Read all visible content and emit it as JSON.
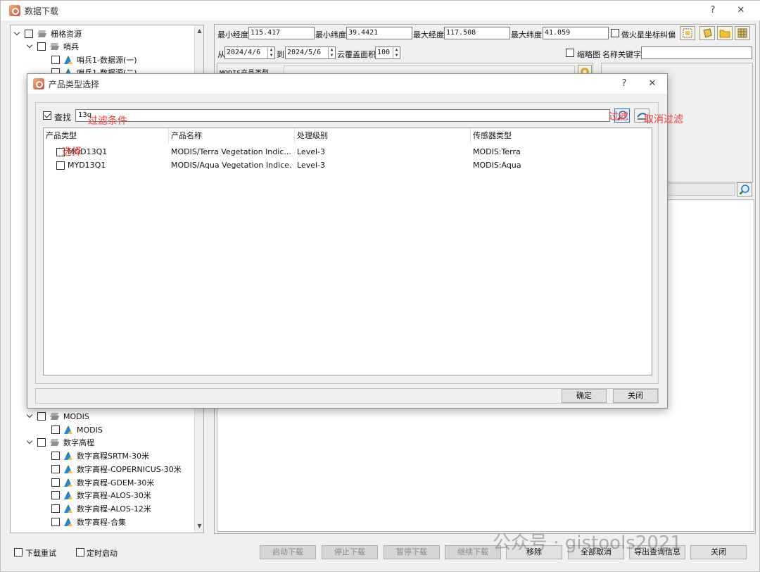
{
  "main_window": {
    "title": "数据下载",
    "help_glyph": "?",
    "close_glyph": "✕"
  },
  "tree": {
    "items": [
      {
        "label": "栅格资源",
        "level": 0,
        "expanded": true,
        "icon": "layers-icon"
      },
      {
        "label": "哨兵",
        "level": 1,
        "expanded": true,
        "icon": "layers-icon"
      },
      {
        "label": "哨兵1-数据源(一)",
        "level": 2,
        "icon": "raster-icon"
      },
      {
        "label": "哨兵1-数据源(二)",
        "level": 2,
        "icon": "raster-icon"
      },
      {
        "label": "MODIS",
        "level": 1,
        "expanded": true,
        "icon": "layers-icon"
      },
      {
        "label": "MODIS",
        "level": 2,
        "icon": "raster-icon"
      },
      {
        "label": "数字高程",
        "level": 1,
        "expanded": true,
        "icon": "layers-icon"
      },
      {
        "label": "数字高程SRTM-30米",
        "level": 2,
        "icon": "raster-icon"
      },
      {
        "label": "数字高程-COPERNICUS-30米",
        "level": 2,
        "icon": "raster-icon"
      },
      {
        "label": "数字高程-GDEM-30米",
        "level": 2,
        "icon": "raster-icon"
      },
      {
        "label": "数字高程-ALOS-30米",
        "level": 2,
        "icon": "raster-icon"
      },
      {
        "label": "数字高程-ALOS-12米",
        "level": 2,
        "icon": "raster-icon"
      },
      {
        "label": "数字高程-合集",
        "level": 2,
        "icon": "raster-icon"
      }
    ]
  },
  "query": {
    "min_lon_label": "最小经度",
    "min_lon": "115.417",
    "min_lat_label": "最小纬度",
    "min_lat": "39.4421",
    "max_lon_label": "最大经度",
    "max_lon": "117.508",
    "max_lat_label": "最大纬度",
    "max_lat": "41.059",
    "mars_label": "做火星坐标纠偏",
    "from_label": "从",
    "from_date": "2024/4/6",
    "to_label": "到",
    "to_date": "2024/5/6",
    "cloud_label": "云覆盖面积",
    "cloud_value": "100",
    "thumb_label": "缩略图",
    "keyword_label": "名称关键字",
    "keyword_value": "",
    "modis_type_label": "MODIS产品类型"
  },
  "dialog": {
    "title": "产品类型选择",
    "help_glyph": "?",
    "close_glyph": "✕",
    "find_label": "查找",
    "find_value": "13q",
    "columns": [
      "产品类型",
      "产品名称",
      "处理级别",
      "传感器类型"
    ],
    "rows": [
      {
        "type": "MOD13Q1",
        "name": "MODIS/Terra Vegetation Indic...",
        "level": "Level-3",
        "sensor": "MODIS:Terra"
      },
      {
        "type": "MYD13Q1",
        "name": "MODIS/Aqua Vegetation Indice...",
        "level": "Level-3",
        "sensor": "MODIS:Aqua"
      }
    ],
    "ok_label": "确定",
    "close_label": "关闭",
    "annotations": {
      "filter_condition": "过滤条件",
      "filter": "过滤",
      "cancel_filter": "取消过滤",
      "select": "选择"
    }
  },
  "bottom": {
    "redownload_label": "下载重试",
    "timed_start_label": "定时启动",
    "buttons": [
      "启动下载",
      "停止下载",
      "暂停下载",
      "继续下载",
      "移除",
      "全部取消",
      "导出查询信息",
      "关闭"
    ]
  },
  "watermark": "公众号 · gistools2021",
  "colors": {
    "annotation": "#f03a3a",
    "accent": "#0a64c8"
  }
}
